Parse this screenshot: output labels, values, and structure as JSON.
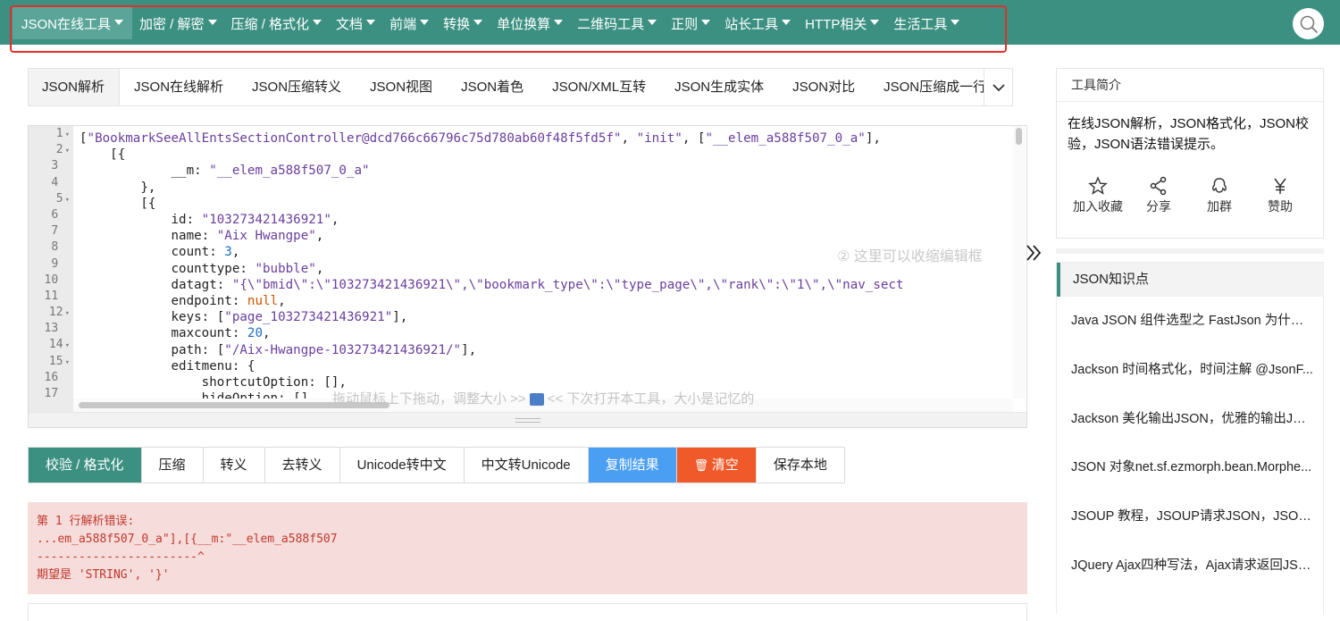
{
  "nav": {
    "items": [
      {
        "label": "JSON在线工具",
        "active": true
      },
      {
        "label": "加密 / 解密"
      },
      {
        "label": "压缩 / 格式化"
      },
      {
        "label": "文档"
      },
      {
        "label": "前端"
      },
      {
        "label": "转换"
      },
      {
        "label": "单位换算"
      },
      {
        "label": "二维码工具"
      },
      {
        "label": "正则"
      },
      {
        "label": "站长工具"
      },
      {
        "label": "HTTP相关"
      },
      {
        "label": "生活工具"
      }
    ],
    "search_icon": "search-icon"
  },
  "tabs": [
    {
      "label": "JSON解析",
      "active": true
    },
    {
      "label": "JSON在线解析"
    },
    {
      "label": "JSON压缩转义"
    },
    {
      "label": "JSON视图"
    },
    {
      "label": "JSON着色"
    },
    {
      "label": "JSON/XML互转"
    },
    {
      "label": "JSON生成实体"
    },
    {
      "label": "JSON对比"
    },
    {
      "label": "JSON压缩成一行"
    }
  ],
  "editor": {
    "line_numbers": [
      "1",
      "2",
      "3",
      "4",
      "5",
      "6",
      "7",
      "8",
      "9",
      "10",
      "11",
      "12",
      "13",
      "14",
      "15",
      "16",
      "17"
    ],
    "folded_lines": [
      1,
      2,
      5,
      12,
      14,
      15
    ],
    "lines": [
      "[\"BookmarkSeeAllEntsSectionController@dcd766c66796c75d780ab60f48f5fd5f\", \"init\", [\"__elem_a588f507_0_a\"],",
      "    [{",
      "            __m: \"__elem_a588f507_0_a\"",
      "        },",
      "        [{",
      "            id: \"103273421436921\",",
      "            name: \"Aix Hwangpe\",",
      "            count: 3,",
      "            counttype: \"bubble\",",
      "            datagt: \"{\\\"bmid\\\":\\\"103273421436921\\\",\\\"bookmark_type\\\":\\\"type_page\\\",\\\"rank\\\":\\\"1\\\",\\\"nav_sect",
      "            endpoint: null,",
      "            keys: [\"page_103273421436921\"],",
      "            maxcount: 20,",
      "            path: [\"/Aix-Hwangpe-103273421436921/\"],",
      "            editmenu: {",
      "                shortcutOption: [],",
      "                hideOption: []"
    ],
    "hint_collapse": "② 这里可以收缩编辑框",
    "hint_drag_left": "拖动鼠标上下拖动，调整大小 >>",
    "hint_drag_right": "<< 下次打开本工具，大小是记忆的"
  },
  "buttons": [
    {
      "label": "校验 / 格式化",
      "style": "primary"
    },
    {
      "label": "压缩"
    },
    {
      "label": "转义"
    },
    {
      "label": "去转义"
    },
    {
      "label": "Unicode转中文"
    },
    {
      "label": "中文转Unicode"
    },
    {
      "label": "复制结果",
      "style": "copy"
    },
    {
      "label": "清空",
      "style": "clear",
      "icon": "trash-icon"
    },
    {
      "label": "保存本地"
    }
  ],
  "error": {
    "text": "第 1 行解析错误:\n...em_a588f507_0_a\"],[{__m:\"__elem_a588f507\n-----------------------^\n期望是 'STRING', '}'"
  },
  "sidebar": {
    "intro_title": "工具简介",
    "intro_text": "在线JSON解析，JSON格式化，JSON校验，JSON语法错误提示。",
    "actions": [
      {
        "label": "加入收藏",
        "icon": "star-icon"
      },
      {
        "label": "分享",
        "icon": "share-icon"
      },
      {
        "label": "加群",
        "icon": "group-icon"
      },
      {
        "label": "赞助",
        "icon": "yuan-icon"
      }
    ],
    "knowledge_title": "JSON知识点",
    "knowledge_items": [
      "Java JSON 组件选型之 FastJson 为什么...",
      "Jackson 时间格式化，时间注解 @JsonF...",
      "Jackson 美化输出JSON，优雅的输出JSO...",
      "JSON 对象net.sf.ezmorph.bean.Morphe...",
      "JSOUP 教程，JSOUP请求JSON，JSOU...",
      "JQuery Ajax四种写法，Ajax请求返回JSO..."
    ]
  },
  "colors": {
    "brand": "#3c9082",
    "copy": "#4a9ff2",
    "clear": "#f05a2a",
    "error_bg": "#f7dcdc",
    "error_text": "#c0392b",
    "highlight": "#e0302a"
  }
}
